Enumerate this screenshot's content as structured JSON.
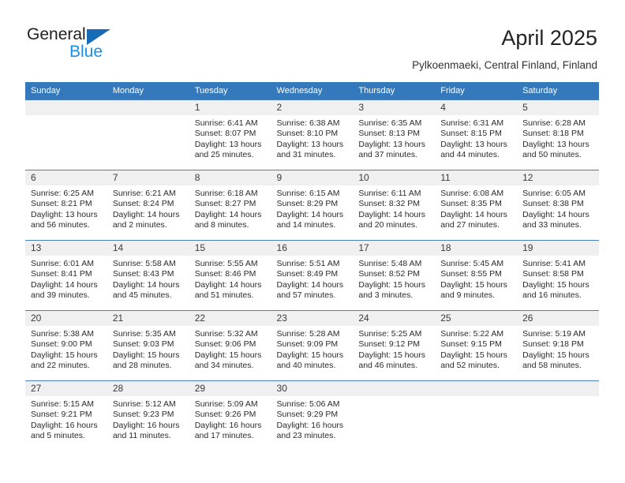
{
  "brand": {
    "name_part1": "General",
    "name_part2": "Blue",
    "triangle_color": "#1a6bb5",
    "blue_color": "#1a8fe3"
  },
  "header": {
    "title": "April 2025",
    "location": "Pylkoenmaeki, Central Finland, Finland"
  },
  "theme": {
    "header_bg": "#3479bb",
    "row_border": "#4a7ebb",
    "daynum_band": "#f0f0f0"
  },
  "weekdays": [
    "Sunday",
    "Monday",
    "Tuesday",
    "Wednesday",
    "Thursday",
    "Friday",
    "Saturday"
  ],
  "weeks": [
    [
      {
        "day": "",
        "empty": true
      },
      {
        "day": "",
        "empty": true
      },
      {
        "day": "1",
        "sunrise": "Sunrise: 6:41 AM",
        "sunset": "Sunset: 8:07 PM",
        "daylight_l1": "Daylight: 13 hours",
        "daylight_l2": "and 25 minutes."
      },
      {
        "day": "2",
        "sunrise": "Sunrise: 6:38 AM",
        "sunset": "Sunset: 8:10 PM",
        "daylight_l1": "Daylight: 13 hours",
        "daylight_l2": "and 31 minutes."
      },
      {
        "day": "3",
        "sunrise": "Sunrise: 6:35 AM",
        "sunset": "Sunset: 8:13 PM",
        "daylight_l1": "Daylight: 13 hours",
        "daylight_l2": "and 37 minutes."
      },
      {
        "day": "4",
        "sunrise": "Sunrise: 6:31 AM",
        "sunset": "Sunset: 8:15 PM",
        "daylight_l1": "Daylight: 13 hours",
        "daylight_l2": "and 44 minutes."
      },
      {
        "day": "5",
        "sunrise": "Sunrise: 6:28 AM",
        "sunset": "Sunset: 8:18 PM",
        "daylight_l1": "Daylight: 13 hours",
        "daylight_l2": "and 50 minutes."
      }
    ],
    [
      {
        "day": "6",
        "sunrise": "Sunrise: 6:25 AM",
        "sunset": "Sunset: 8:21 PM",
        "daylight_l1": "Daylight: 13 hours",
        "daylight_l2": "and 56 minutes."
      },
      {
        "day": "7",
        "sunrise": "Sunrise: 6:21 AM",
        "sunset": "Sunset: 8:24 PM",
        "daylight_l1": "Daylight: 14 hours",
        "daylight_l2": "and 2 minutes."
      },
      {
        "day": "8",
        "sunrise": "Sunrise: 6:18 AM",
        "sunset": "Sunset: 8:27 PM",
        "daylight_l1": "Daylight: 14 hours",
        "daylight_l2": "and 8 minutes."
      },
      {
        "day": "9",
        "sunrise": "Sunrise: 6:15 AM",
        "sunset": "Sunset: 8:29 PM",
        "daylight_l1": "Daylight: 14 hours",
        "daylight_l2": "and 14 minutes."
      },
      {
        "day": "10",
        "sunrise": "Sunrise: 6:11 AM",
        "sunset": "Sunset: 8:32 PM",
        "daylight_l1": "Daylight: 14 hours",
        "daylight_l2": "and 20 minutes."
      },
      {
        "day": "11",
        "sunrise": "Sunrise: 6:08 AM",
        "sunset": "Sunset: 8:35 PM",
        "daylight_l1": "Daylight: 14 hours",
        "daylight_l2": "and 27 minutes."
      },
      {
        "day": "12",
        "sunrise": "Sunrise: 6:05 AM",
        "sunset": "Sunset: 8:38 PM",
        "daylight_l1": "Daylight: 14 hours",
        "daylight_l2": "and 33 minutes."
      }
    ],
    [
      {
        "day": "13",
        "sunrise": "Sunrise: 6:01 AM",
        "sunset": "Sunset: 8:41 PM",
        "daylight_l1": "Daylight: 14 hours",
        "daylight_l2": "and 39 minutes."
      },
      {
        "day": "14",
        "sunrise": "Sunrise: 5:58 AM",
        "sunset": "Sunset: 8:43 PM",
        "daylight_l1": "Daylight: 14 hours",
        "daylight_l2": "and 45 minutes."
      },
      {
        "day": "15",
        "sunrise": "Sunrise: 5:55 AM",
        "sunset": "Sunset: 8:46 PM",
        "daylight_l1": "Daylight: 14 hours",
        "daylight_l2": "and 51 minutes."
      },
      {
        "day": "16",
        "sunrise": "Sunrise: 5:51 AM",
        "sunset": "Sunset: 8:49 PM",
        "daylight_l1": "Daylight: 14 hours",
        "daylight_l2": "and 57 minutes."
      },
      {
        "day": "17",
        "sunrise": "Sunrise: 5:48 AM",
        "sunset": "Sunset: 8:52 PM",
        "daylight_l1": "Daylight: 15 hours",
        "daylight_l2": "and 3 minutes."
      },
      {
        "day": "18",
        "sunrise": "Sunrise: 5:45 AM",
        "sunset": "Sunset: 8:55 PM",
        "daylight_l1": "Daylight: 15 hours",
        "daylight_l2": "and 9 minutes."
      },
      {
        "day": "19",
        "sunrise": "Sunrise: 5:41 AM",
        "sunset": "Sunset: 8:58 PM",
        "daylight_l1": "Daylight: 15 hours",
        "daylight_l2": "and 16 minutes."
      }
    ],
    [
      {
        "day": "20",
        "sunrise": "Sunrise: 5:38 AM",
        "sunset": "Sunset: 9:00 PM",
        "daylight_l1": "Daylight: 15 hours",
        "daylight_l2": "and 22 minutes."
      },
      {
        "day": "21",
        "sunrise": "Sunrise: 5:35 AM",
        "sunset": "Sunset: 9:03 PM",
        "daylight_l1": "Daylight: 15 hours",
        "daylight_l2": "and 28 minutes."
      },
      {
        "day": "22",
        "sunrise": "Sunrise: 5:32 AM",
        "sunset": "Sunset: 9:06 PM",
        "daylight_l1": "Daylight: 15 hours",
        "daylight_l2": "and 34 minutes."
      },
      {
        "day": "23",
        "sunrise": "Sunrise: 5:28 AM",
        "sunset": "Sunset: 9:09 PM",
        "daylight_l1": "Daylight: 15 hours",
        "daylight_l2": "and 40 minutes."
      },
      {
        "day": "24",
        "sunrise": "Sunrise: 5:25 AM",
        "sunset": "Sunset: 9:12 PM",
        "daylight_l1": "Daylight: 15 hours",
        "daylight_l2": "and 46 minutes."
      },
      {
        "day": "25",
        "sunrise": "Sunrise: 5:22 AM",
        "sunset": "Sunset: 9:15 PM",
        "daylight_l1": "Daylight: 15 hours",
        "daylight_l2": "and 52 minutes."
      },
      {
        "day": "26",
        "sunrise": "Sunrise: 5:19 AM",
        "sunset": "Sunset: 9:18 PM",
        "daylight_l1": "Daylight: 15 hours",
        "daylight_l2": "and 58 minutes."
      }
    ],
    [
      {
        "day": "27",
        "sunrise": "Sunrise: 5:15 AM",
        "sunset": "Sunset: 9:21 PM",
        "daylight_l1": "Daylight: 16 hours",
        "daylight_l2": "and 5 minutes."
      },
      {
        "day": "28",
        "sunrise": "Sunrise: 5:12 AM",
        "sunset": "Sunset: 9:23 PM",
        "daylight_l1": "Daylight: 16 hours",
        "daylight_l2": "and 11 minutes."
      },
      {
        "day": "29",
        "sunrise": "Sunrise: 5:09 AM",
        "sunset": "Sunset: 9:26 PM",
        "daylight_l1": "Daylight: 16 hours",
        "daylight_l2": "and 17 minutes."
      },
      {
        "day": "30",
        "sunrise": "Sunrise: 5:06 AM",
        "sunset": "Sunset: 9:29 PM",
        "daylight_l1": "Daylight: 16 hours",
        "daylight_l2": "and 23 minutes."
      },
      {
        "day": "",
        "empty": true
      },
      {
        "day": "",
        "empty": true
      },
      {
        "day": "",
        "empty": true
      }
    ]
  ]
}
